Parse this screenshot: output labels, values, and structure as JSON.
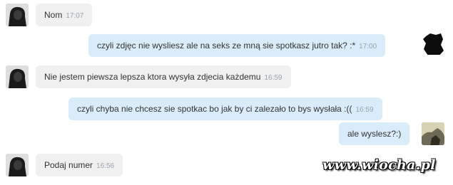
{
  "messages": [
    {
      "text": "Nom",
      "time": "17:07"
    },
    {
      "text": "czyli zdjęc nie wysliesz ale na seks ze mną sie spotkasz jutro tak? :*",
      "time": "17:00"
    },
    {
      "text": "Nie jestem piewsza lepsza ktora wysyła zdjecia każdemu",
      "time": "16:59"
    },
    {
      "text": "czyli chyba nie chcesz sie spotkac bo jak by ci zalezało to bys wysłała :((",
      "time": "16:59"
    },
    {
      "text": "ale wyslesz?:)",
      "time": ""
    },
    {
      "text": "Podaj numer",
      "time": "16:56"
    }
  ],
  "watermark": "www.wiocha.pl",
  "colors": {
    "incoming_bubble": "#f0f0f0",
    "outgoing_bubble": "#d8ecf9",
    "timestamp": "#9aa4ad"
  }
}
